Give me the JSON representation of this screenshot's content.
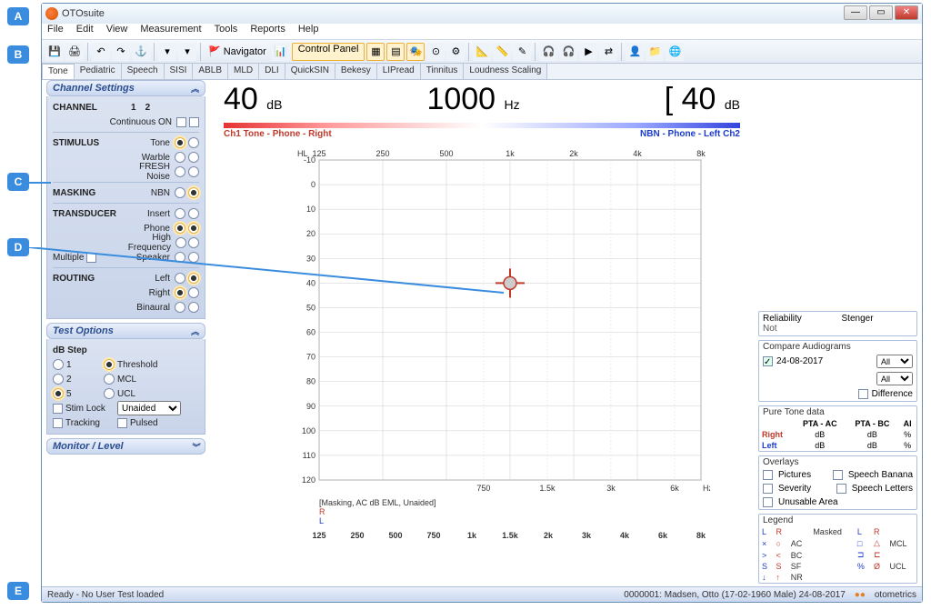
{
  "callouts": [
    "A",
    "B",
    "C",
    "D",
    "E"
  ],
  "titlebar": {
    "title": "OTOsuite"
  },
  "menubar": [
    "File",
    "Edit",
    "View",
    "Measurement",
    "Tools",
    "Reports",
    "Help"
  ],
  "toolbar": {
    "navigator": "Navigator",
    "control_panel": "Control Panel"
  },
  "tabs": [
    "Tone",
    "Pediatric",
    "Speech",
    "SISI",
    "ABLB",
    "MLD",
    "DLI",
    "QuickSIN",
    "Bekesy",
    "LIPread",
    "Tinnitus",
    "Loudness Scaling"
  ],
  "active_tab": 0,
  "readout": {
    "left_val": "40",
    "left_unit": "dB",
    "center_val": "1000",
    "center_unit": "Hz",
    "right_prefix": "[",
    "right_val": "40",
    "right_unit": "dB"
  },
  "ch_labels": {
    "left": "Ch1  Tone - Phone - Right",
    "right": "NBN - Phone - Left  Ch2"
  },
  "channel_settings": {
    "header": "Channel Settings",
    "channel_label": "CHANNEL",
    "cols": [
      "1",
      "2"
    ],
    "continuous": "Continuous ON",
    "stimulus_label": "STIMULUS",
    "stimulus_opts": [
      "Tone",
      "Warble",
      "FRESH Noise"
    ],
    "masking_label": "MASKING",
    "masking_opt": "NBN",
    "transducer_label": "TRANSDUCER",
    "transducer_opts": [
      "Insert",
      "Phone",
      "High Frequency"
    ],
    "multiple": "Multiple",
    "speaker": "Speaker",
    "routing_label": "ROUTING",
    "routing_opts": [
      "Left",
      "Right",
      "Binaural"
    ]
  },
  "test_options": {
    "header": "Test Options",
    "dbstep": "dB Step",
    "steps": [
      "1",
      "2",
      "5"
    ],
    "rcol": [
      "Threshold",
      "MCL",
      "UCL"
    ],
    "stimlock": "Stim Lock",
    "unaided": "Unaided",
    "tracking": "Tracking",
    "pulsed": "Pulsed"
  },
  "monitor": {
    "header": "Monitor / Level"
  },
  "chart_data": {
    "type": "scatter",
    "title": "",
    "xlabel": "Hz",
    "ylabel": "HL",
    "x_ticks_major": [
      125,
      250,
      500,
      1000,
      2000,
      4000,
      8000
    ],
    "x_tick_labels": [
      "125",
      "250",
      "500",
      "1k",
      "2k",
      "4k",
      "8k"
    ],
    "x_ticks_minor": [
      750,
      1500,
      3000,
      6000
    ],
    "x_minor_labels": [
      "750",
      "1.5k",
      "3k",
      "6k"
    ],
    "y_ticks": [
      -10,
      0,
      10,
      20,
      30,
      40,
      50,
      60,
      70,
      80,
      90,
      100,
      110,
      120
    ],
    "xlim": [
      125,
      8000
    ],
    "ylim": [
      120,
      -10
    ],
    "cursor": {
      "freq": 1000,
      "level": 40
    },
    "series": [
      {
        "name": "R",
        "color": "#c0392b",
        "values": []
      },
      {
        "name": "L",
        "color": "#1a3bcc",
        "values": []
      }
    ],
    "annotation": "[Masking, AC dB EML, Unaided]",
    "bottom_scale": [
      "125",
      "250",
      "500",
      "750",
      "1k",
      "1.5k",
      "2k",
      "3k",
      "4k",
      "6k",
      "8k"
    ]
  },
  "right_panels": {
    "reliability": "Reliability",
    "not": "Not",
    "stenger": "Stenger",
    "compare": "Compare Audiograms",
    "date": "24-08-2017",
    "all": "All",
    "difference": "Difference",
    "ptd": "Pure Tone data",
    "pta_ac": "PTA - AC",
    "pta_bc": "PTA - BC",
    "ai": "AI",
    "right": "Right",
    "left": "Left",
    "db": "dB",
    "pct": "%",
    "overlays": "Overlays",
    "pictures": "Pictures",
    "speech_banana": "Speech Banana",
    "severity": "Severity",
    "speech_letters": "Speech Letters",
    "unusable": "Unusable Area",
    "legend": "Legend",
    "legend_rows": [
      [
        "L",
        "R",
        "",
        "Masked",
        "L",
        "R",
        ""
      ],
      [
        "×",
        "○",
        "AC",
        "",
        "□",
        "△",
        "MCL"
      ],
      [
        ">",
        "<",
        "BC",
        "",
        "⊐",
        "⊏",
        ""
      ],
      [
        "S",
        "S",
        "SF",
        "",
        "%",
        "Ø",
        "UCL"
      ],
      [
        "↓",
        "↑",
        "NR",
        "",
        "",
        "",
        ""
      ]
    ]
  },
  "statusbar": {
    "left": "Ready - No User Test loaded",
    "patient": "0000001: Madsen, Otto (17-02-1960 Male)  24-08-2017",
    "brand": "otometrics"
  }
}
